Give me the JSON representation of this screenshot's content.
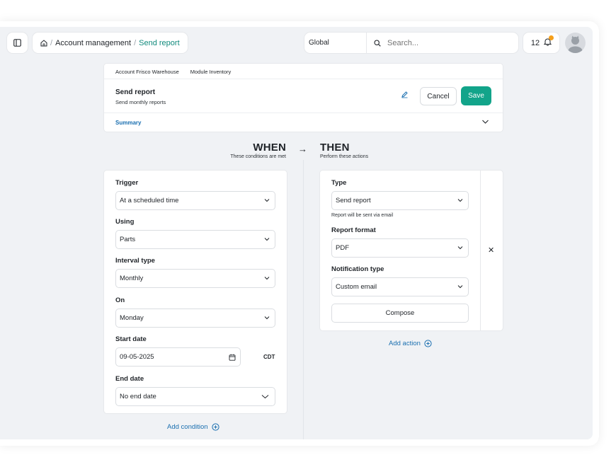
{
  "topbar": {
    "breadcrumb": {
      "parent": "Account management",
      "separator": "/",
      "current": "Send report"
    },
    "scope_select": "Global",
    "search_placeholder": "Search...",
    "notification_count": "12"
  },
  "header": {
    "account": "Account Frisco Warehouse",
    "module": "Module Inventory",
    "title": "Send report",
    "description": "Send monthly reports",
    "cancel_label": "Cancel",
    "save_label": "Save",
    "summary_label": "Summary"
  },
  "when": {
    "heading": "WHEN",
    "subheading": "These conditions are met"
  },
  "then": {
    "heading": "THEN",
    "subheading": "Perform these actions"
  },
  "conditions": {
    "trigger": {
      "label": "Trigger",
      "value": "At a scheduled time"
    },
    "using": {
      "label": "Using",
      "value": "Parts"
    },
    "interval_type": {
      "label": "Interval type",
      "value": "Monthly"
    },
    "on": {
      "label": "On",
      "value": "Monday"
    },
    "start_date": {
      "label": "Start date",
      "value": "09-05-2025",
      "timezone": "CDT"
    },
    "end_date": {
      "label": "End date",
      "value": "No end date"
    },
    "add_label": "Add condition"
  },
  "actions": {
    "type": {
      "label": "Type",
      "value": "Send report",
      "help": "Report will be sent via email"
    },
    "report_format": {
      "label": "Report format",
      "value": "PDF"
    },
    "notification_type": {
      "label": "Notification type",
      "value": "Custom email"
    },
    "compose_label": "Compose",
    "add_label": "Add action"
  },
  "colors": {
    "accent": "#12a48a",
    "link": "#1a6fb0",
    "badge": "#f59f1a",
    "canvas": "#f0f2f5"
  },
  "icons": [
    "sidebar-toggle-icon",
    "home-icon",
    "search-icon",
    "bell-icon",
    "avatar-icon",
    "pencil-icon",
    "chevron-down-icon",
    "arrow-right-icon",
    "close-icon",
    "calendar-icon",
    "plus-circle-icon"
  ]
}
